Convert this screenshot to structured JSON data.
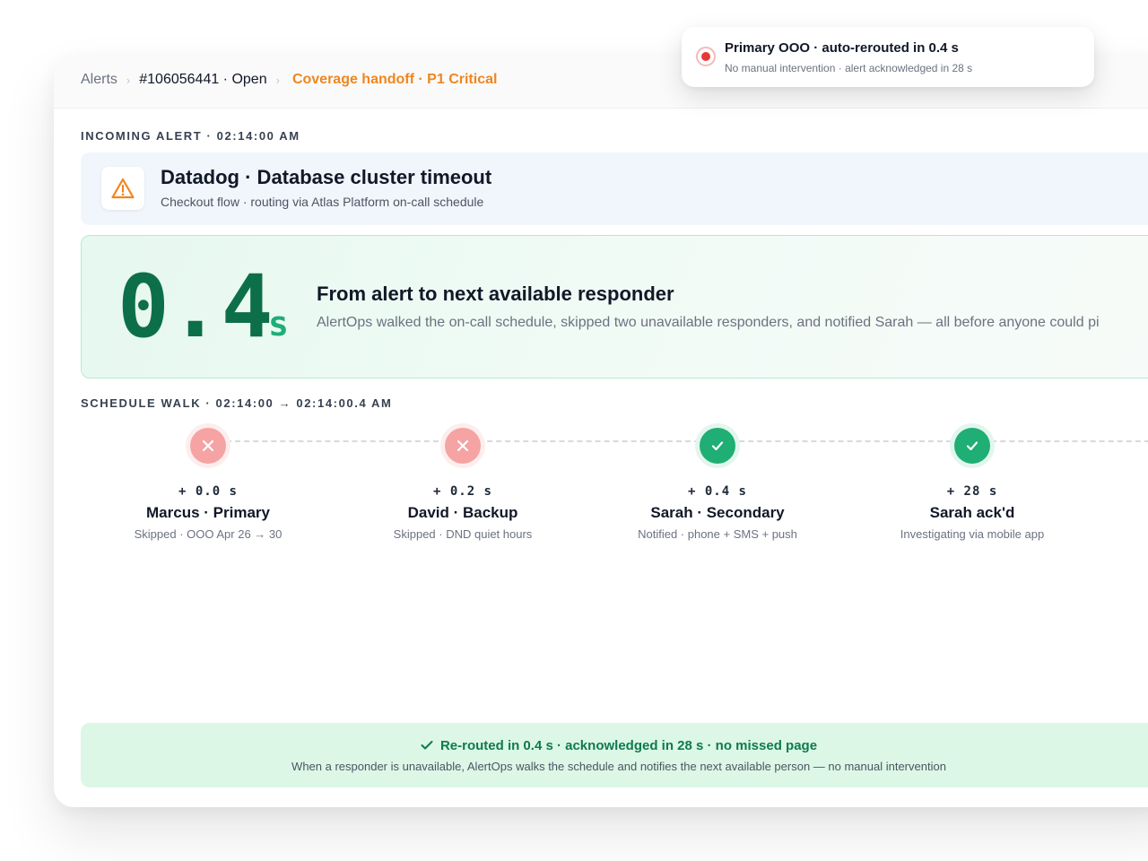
{
  "breadcrumb": {
    "root": "Alerts",
    "incident": "#106056441 · Open",
    "context": "Coverage handoff · P1 Critical"
  },
  "incoming": {
    "label": "INCOMING ALERT · 02:14:00 AM",
    "icon": "warning-icon",
    "title": "Datadog · Database cluster timeout",
    "subtitle": "Checkout flow · routing via Atlas Platform on-call schedule"
  },
  "metric": {
    "value": "0.4",
    "unit": "s",
    "title": "From alert to next available responder",
    "description": "AlertOps walked the on-call schedule, skipped two unavailable responders, and notified Sarah — all before anyone could pi"
  },
  "schedule": {
    "label": "SCHEDULE WALK · 02:14:00 → 02:14:00.4 AM",
    "steps": [
      {
        "status": "skipped",
        "time": "+ 0.0 s",
        "name": "Marcus · Primary",
        "note": "Skipped · OOO Apr 26 → 30"
      },
      {
        "status": "skipped",
        "time": "+ 0.2 s",
        "name": "David · Backup",
        "note": "Skipped · DND quiet hours"
      },
      {
        "status": "notified",
        "time": "+ 0.4 s",
        "name": "Sarah · Secondary",
        "note": "Notified · phone + SMS + push"
      },
      {
        "status": "acknowledged",
        "time": "+ 28 s",
        "name": "Sarah ack'd",
        "note": "Investigating via mobile app"
      }
    ]
  },
  "footer": {
    "headline": "Re-routed in 0.4 s · acknowledged in 28 s · no missed page",
    "subtext": "When a responder is unavailable, AlertOps walks the schedule and notifies the next available person — no manual intervention"
  },
  "toast": {
    "title": "Primary OOO · auto-rerouted in 0.4 s",
    "subtitle": "No manual intervention · alert acknowledged in 28 s"
  },
  "colors": {
    "accent_orange": "#f0861e",
    "success_green": "#1fae74",
    "metric_green": "#0d6f4a",
    "fail_red": "#f5a3a3",
    "toast_red": "#e53935"
  }
}
